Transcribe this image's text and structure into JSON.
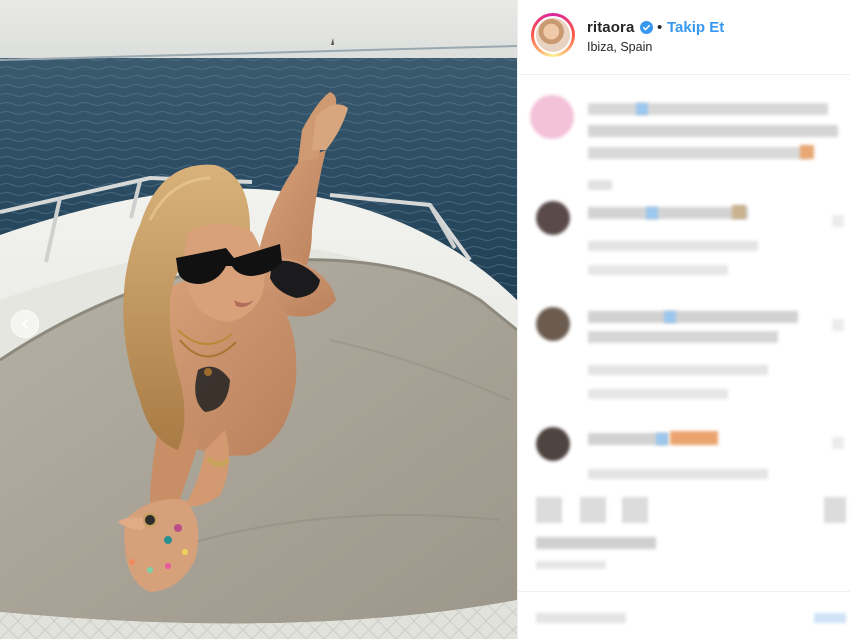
{
  "post": {
    "username": "ritaora",
    "separator": "•",
    "follow_label": "Takip Et",
    "location": "Ibiza, Spain",
    "verified": true
  },
  "icons": {
    "verified": "verified-badge-icon",
    "prev": "chevron-left-icon",
    "more": "more-options-icon"
  },
  "colors": {
    "follow": "#3897f0",
    "verified": "#3897f0",
    "text": "#262626",
    "border": "#efefef"
  }
}
